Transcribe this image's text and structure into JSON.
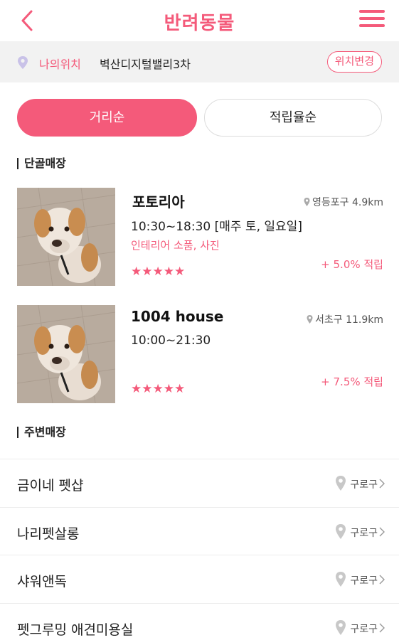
{
  "header": {
    "title": "반려동물"
  },
  "location": {
    "label": "나의위치",
    "value": "벽산디지털밸리3차",
    "change_label": "위치변경"
  },
  "sort": {
    "distance_label": "거리순",
    "rate_label": "적립율순",
    "active": "distance"
  },
  "sections": {
    "favorite_title": "단골매장",
    "nearby_title": "주변매장"
  },
  "favorite_stores": [
    {
      "name": "포토리아",
      "distance": "영등포구 4.9km",
      "hours": "10:30~18:30 [매주 토, 일요일]",
      "category": "인테리어 소품, 사진",
      "reward": "+ 5.0% 적립",
      "stars": "★★★★★",
      "rating": 5
    },
    {
      "name": "1004 house",
      "distance": "서초구 11.9km",
      "hours": "10:00~21:30",
      "category": "",
      "reward": "+ 7.5% 적립",
      "stars": "★★★★★",
      "rating": 5
    }
  ],
  "nearby_stores": [
    {
      "name": "금이네 펫샵",
      "region": "구로구"
    },
    {
      "name": "나리펫살롱",
      "region": "구로구"
    },
    {
      "name": "샤워앤독",
      "region": "구로구"
    },
    {
      "name": "펫그루밍 애견미용실",
      "region": "구로구"
    }
  ],
  "colors": {
    "accent": "#f45a7a",
    "location_bar_bg": "#f2f2f2",
    "pin_gray": "#c8c8c8"
  },
  "icons": {
    "back": "chevron-left-icon",
    "menu": "hamburger-menu-icon",
    "location": "map-pin-icon",
    "chevron": "chevron-right-icon"
  }
}
